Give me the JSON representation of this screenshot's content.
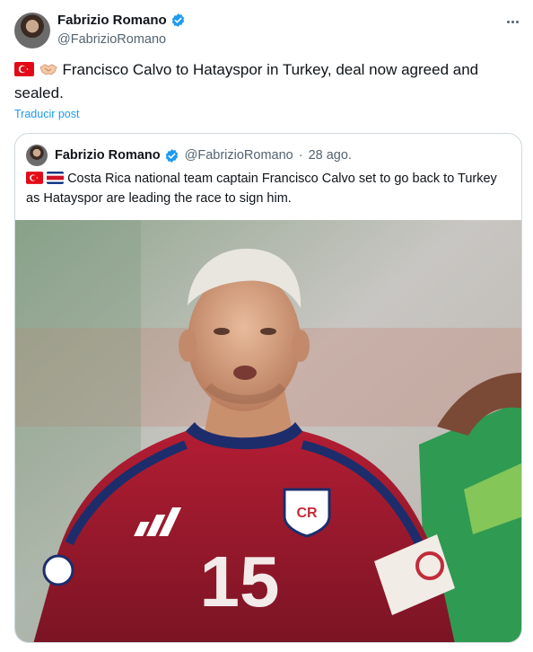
{
  "author": {
    "name": "Fabrizio Romano",
    "handle": "@FabrizioRomano",
    "avatar_icon": "avatar-photo"
  },
  "tweet": {
    "emoji": [
      "turkey-flag",
      "handshake"
    ],
    "text": "Francisco Calvo to Hatayspor in Turkey, deal now agreed and sealed.",
    "translate_label": "Traducir post"
  },
  "quote": {
    "name": "Fabrizio Romano",
    "handle": "@FabrizioRomano",
    "separator": "·",
    "date": "28 ago.",
    "emoji": [
      "turkey-flag",
      "costa-rica-flag"
    ],
    "text": "Costa Rica national team captain Francisco Calvo set to go back to Turkey as Hatayspor are leading the race to sign him.",
    "image": {
      "shirt_number": "15",
      "crest_text": "CR",
      "armband_text": "C"
    }
  },
  "colors": {
    "accent": "#1d9bf0",
    "text": "#0f1419",
    "secondary": "#536471",
    "border": "#cfd9de",
    "jersey": "#9e1a2a",
    "jersey_dark": "#1d2d6b"
  }
}
